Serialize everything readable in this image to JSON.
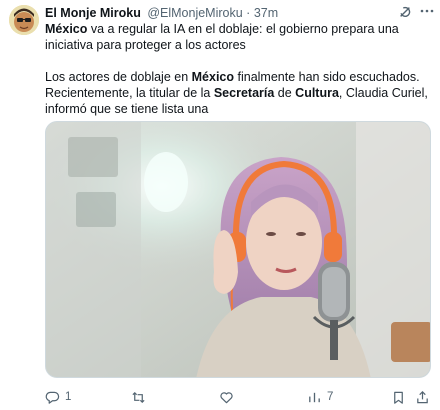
{
  "tweet": {
    "author": {
      "display_name": "El Monje Miroku",
      "handle": "@ElMonjeMiroku",
      "separator": "·",
      "time": "37m"
    },
    "text1": {
      "bold1": "México",
      "rest": " va a regular la IA en el doblaje: el gobierno prepara una iniciativa para proteger a los actores"
    },
    "text2": {
      "part1": "Los actores de doblaje en ",
      "bold1": "México",
      "part2": " finalmente han sido escuchados. Recientemente, la titular de la ",
      "bold2": "Secretaría",
      "part3": " de ",
      "bold3": "Cultura",
      "part4": ", Claudia Curiel, informó que se tiene lista una"
    },
    "actions": {
      "reply_count": "1",
      "retweet_count": "",
      "like_count": "",
      "views_count": "7"
    },
    "icons": {
      "grok": "grok-icon",
      "more": "more-options-icon",
      "reply": "reply-icon",
      "retweet": "retweet-icon",
      "like": "heart-icon",
      "views": "views-chart-icon",
      "bookmark": "bookmark-icon",
      "share": "share-icon"
    },
    "colors": {
      "text": "#0f1419",
      "secondary": "#536471",
      "headphones": "#f07a3a",
      "hair": "#b48ab8"
    }
  }
}
